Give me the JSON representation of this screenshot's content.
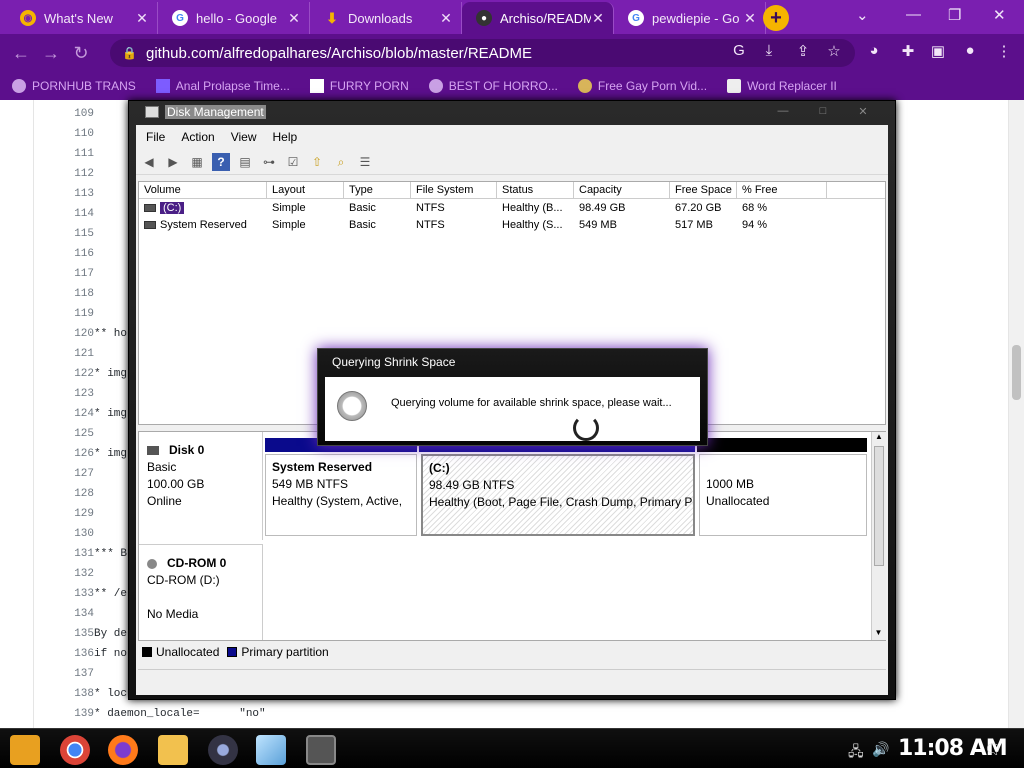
{
  "browser": {
    "tabs": [
      {
        "label": "What's New",
        "icon": "chrome-icon",
        "color": "#f5b400",
        "glyph": "◉"
      },
      {
        "label": "hello - Google",
        "icon": "google-icon",
        "color": "#ffffff",
        "glyph": "G"
      },
      {
        "label": "Downloads",
        "icon": "download-icon",
        "color": "#5aa0ff",
        "glyph": "⬇"
      },
      {
        "label": "Archiso/READM",
        "icon": "github-icon",
        "color": "#ffffff",
        "glyph": "●"
      },
      {
        "label": "pewdiepie - Go",
        "icon": "google-icon",
        "color": "#ffffff",
        "glyph": "G"
      }
    ],
    "new_tab": "+",
    "url": "github.com/alfredopalhares/Archiso/blob/master/README",
    "bookmarks": [
      {
        "label": "PORNHUB TRANS"
      },
      {
        "label": "Anal Prolapse Time..."
      },
      {
        "label": "FURRY PORN"
      },
      {
        "label": "BEST OF HORRO..."
      },
      {
        "label": "Free Gay Porn Vid..."
      },
      {
        "label": "Word Replacer II"
      }
    ]
  },
  "code": {
    "lines": [
      {
        "n": "109",
        "t": ""
      },
      {
        "n": "110",
        "t": ""
      },
      {
        "n": "111",
        "t": ""
      },
      {
        "n": "112",
        "t": ""
      },
      {
        "n": "113",
        "t": ""
      },
      {
        "n": "114",
        "t": ""
      },
      {
        "n": "115",
        "t": ""
      },
      {
        "n": "116",
        "t": ""
      },
      {
        "n": "117",
        "t": ""
      },
      {
        "n": "118",
        "t": ""
      },
      {
        "n": "119",
        "t": ""
      },
      {
        "n": "120",
        "t": "** ho"
      },
      {
        "n": "121",
        "t": ""
      },
      {
        "n": "122",
        "t": "* img"
      },
      {
        "n": "123",
        "t": ""
      },
      {
        "n": "124",
        "t": "* img"
      },
      {
        "n": "125",
        "t": ""
      },
      {
        "n": "126",
        "t": "* img"
      },
      {
        "n": "127",
        "t": ""
      },
      {
        "n": "128",
        "t": ""
      },
      {
        "n": "129",
        "t": ""
      },
      {
        "n": "130",
        "t": ""
      },
      {
        "n": "131",
        "t": "*** B"
      },
      {
        "n": "132",
        "t": ""
      },
      {
        "n": "133",
        "t": "** /e"
      },
      {
        "n": "134",
        "t": ""
      },
      {
        "n": "135",
        "t": "By de"
      },
      {
        "n": "136",
        "t": "if no"
      },
      {
        "n": "137",
        "t": ""
      },
      {
        "n": "138",
        "t": "* loc"
      },
      {
        "n": "139",
        "t": "* daemon_locale=      \"no\""
      }
    ]
  },
  "disk_mgmt": {
    "title": "Disk Management",
    "menu": [
      "File",
      "Action",
      "View",
      "Help"
    ],
    "columns": [
      "Volume",
      "Layout",
      "Type",
      "File System",
      "Status",
      "Capacity",
      "Free Space",
      "% Free"
    ],
    "volumes": [
      {
        "volume": "(C:)",
        "layout": "Simple",
        "type": "Basic",
        "fs": "NTFS",
        "status": "Healthy (B...",
        "capacity": "98.49 GB",
        "free": "67.20 GB",
        "pct": "68 %"
      },
      {
        "volume": "System Reserved",
        "layout": "Simple",
        "type": "Basic",
        "fs": "NTFS",
        "status": "Healthy (S...",
        "capacity": "549 MB",
        "free": "517 MB",
        "pct": "94 %"
      }
    ],
    "disk0": {
      "name": "Disk 0",
      "kind": "Basic",
      "size": "100.00 GB",
      "state": "Online",
      "partitions": [
        {
          "name": "System Reserved",
          "size": "549 MB NTFS",
          "status": "Healthy (System, Active,"
        },
        {
          "name": "(C:)",
          "size": "98.49 GB NTFS",
          "status": "Healthy (Boot, Page File, Crash Dump, Primary Pa"
        },
        {
          "name": "",
          "size": "1000 MB",
          "status": "Unallocated"
        }
      ]
    },
    "cdrom": {
      "name": "CD-ROM 0",
      "kind": "CD-ROM (D:)",
      "state": "No Media"
    },
    "legend": [
      {
        "label": "Unallocated",
        "color": "#000000"
      },
      {
        "label": "Primary partition",
        "color": "#0a0a8c"
      }
    ]
  },
  "dialog": {
    "title": "Querying Shrink Space",
    "message": "Querying volume for available shrink space, please wait..."
  },
  "taskbar": {
    "time": "11:08 AM"
  },
  "colors": {
    "browser_purple": "#7a1fb0",
    "toolbar_purple": "#5c0f8c",
    "primary_partition": "#0a0a8c"
  }
}
